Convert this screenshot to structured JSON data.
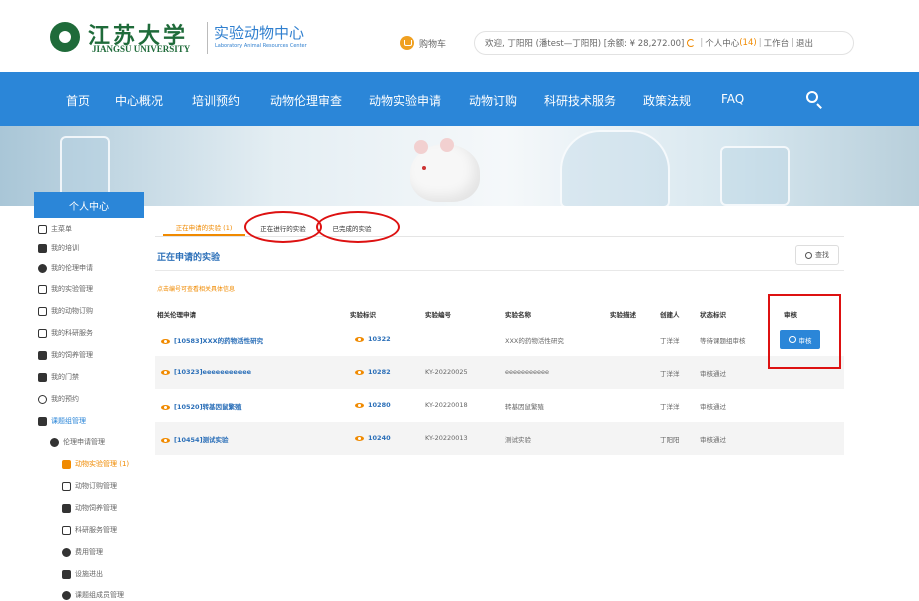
{
  "header": {
    "univ_cn": "江苏大学",
    "univ_en": "JIANGSU UNIVERSITY",
    "center_cn": "实验动物中心",
    "center_en": "Laboratory Animal Resources Center",
    "cart_label": "购物车",
    "user_greeting": "欢迎, 丁阳阳 (潘test—丁阳阳) [余额: ¥ 28,272.00]",
    "personal_center": "个人中心",
    "notification_count": "(14)",
    "workbench": "工作台",
    "logout": "退出"
  },
  "nav": {
    "items": [
      "首页",
      "中心概况",
      "培训预约",
      "动物伦理审查",
      "动物实验申请",
      "动物订购",
      "科研技术服务",
      "政策法规",
      "FAQ"
    ],
    "search_icon": "search-icon"
  },
  "sidebar": {
    "title": "个人中心",
    "items": [
      {
        "label": "主菜单",
        "icon": "home-icon"
      },
      {
        "label": "我的培训",
        "icon": "training-icon"
      },
      {
        "label": "我的伦理申请",
        "icon": "heart-icon"
      },
      {
        "label": "我的实验管理",
        "icon": "flask-icon"
      },
      {
        "label": "我的动物订购",
        "icon": "document-icon"
      },
      {
        "label": "我的科研服务",
        "icon": "document-icon"
      },
      {
        "label": "我的饲养管理",
        "icon": "animal-icon"
      },
      {
        "label": "我的门禁",
        "icon": "door-icon"
      },
      {
        "label": "我的预约",
        "icon": "clock-icon"
      },
      {
        "label": "课题组管理",
        "icon": "group-icon"
      }
    ],
    "sub_items": [
      {
        "label": "伦理申请管理",
        "icon": "heart-icon"
      },
      {
        "label": "动物实验管理 (1)",
        "icon": "list-icon",
        "active": true
      },
      {
        "label": "动物订购管理",
        "icon": "document-icon"
      },
      {
        "label": "动物饲养管理",
        "icon": "animal-icon"
      },
      {
        "label": "科研服务管理",
        "icon": "document-icon"
      },
      {
        "label": "费用管理",
        "icon": "money-icon"
      },
      {
        "label": "设施进出",
        "icon": "door-icon"
      },
      {
        "label": "课题组成员管理",
        "icon": "person-icon"
      }
    ]
  },
  "tabs": [
    "正在申请的实验 (1)",
    "正在进行的实验",
    "已完成的实验"
  ],
  "content": {
    "section_title": "正在申请的实验",
    "query_button": "查找",
    "hint": "点击编号可查看相关具体信息"
  },
  "table": {
    "headers": [
      "相关伦理申请",
      "实验标识",
      "实验编号",
      "实验名称",
      "实验描述",
      "创建人",
      "状态标识",
      "审核"
    ],
    "rows": [
      {
        "ethics": "[10583]XXX的药物活性研究",
        "exp_id": "10322",
        "exp_no": "",
        "name": "XXX的药物活性研究",
        "desc": "",
        "creator": "丁洋洋",
        "status": "等待课题组审核",
        "action": "审核"
      },
      {
        "ethics": "[10323]eeeeeeeeeee",
        "exp_id": "10282",
        "exp_no": "KY-20220025",
        "name": "eeeeeeeeeee",
        "desc": "",
        "creator": "丁洋洋",
        "status": "审核通过",
        "action": ""
      },
      {
        "ethics": "[10520]转基因鼠繁殖",
        "exp_id": "10280",
        "exp_no": "KY-20220018",
        "name": "转基因鼠繁殖",
        "desc": "",
        "creator": "丁洋洋",
        "status": "审核通过",
        "action": ""
      },
      {
        "ethics": "[10454]测试实验",
        "exp_id": "10240",
        "exp_no": "KY-20220013",
        "name": "测试实验",
        "desc": "",
        "creator": "丁阳阳",
        "status": "审核通过",
        "action": ""
      }
    ]
  }
}
